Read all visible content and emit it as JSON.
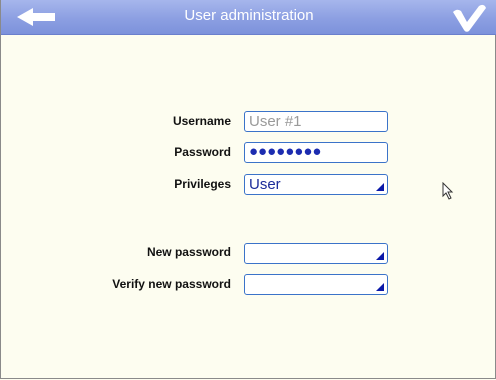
{
  "header": {
    "title": "User administration",
    "back_icon": "back-arrow-icon",
    "confirm_icon": "checkmark-icon"
  },
  "form": {
    "username": {
      "label": "Username",
      "placeholder": "User #1"
    },
    "password": {
      "label": "Password",
      "value": "●●●●●●●●"
    },
    "privileges": {
      "label": "Privileges",
      "value": "User"
    },
    "new_password": {
      "label": "New password",
      "value": ""
    },
    "verify_password": {
      "label": "Verify new password",
      "value": ""
    }
  },
  "colors": {
    "titlebar": "#8c9fe2",
    "background": "#fdfdf0",
    "field_border": "#3b73c9",
    "value_text": "#1c2c9a"
  }
}
